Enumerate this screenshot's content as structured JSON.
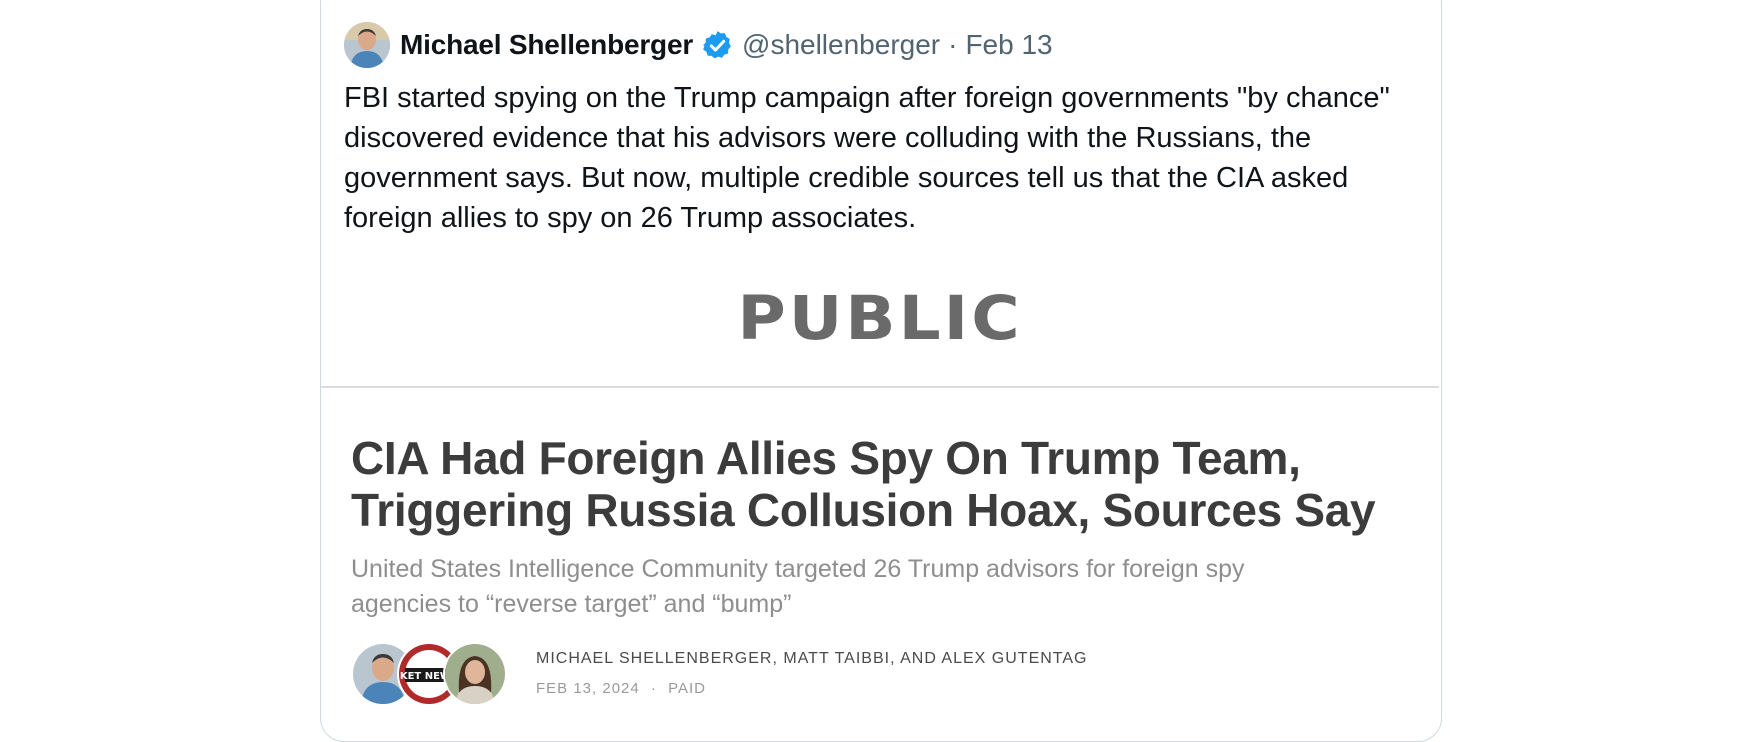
{
  "tweet": {
    "author_name": "Michael Shellenberger",
    "handle": "@shellenberger",
    "separator": "·",
    "date": "Feb 13",
    "text": "FBI started spying on the Trump campaign after foreign governments \"by chance\" discovered evidence that his advisors were colluding with the Russians, the government says. But now, multiple credible sources tell us that the CIA asked foreign allies to spy on 26 Trump associates."
  },
  "article": {
    "publication": "PUBLIC",
    "headline": "CIA Had Foreign Allies Spy On Trump Team, Triggering Russia Collusion Hoax, Sources Say",
    "subtitle": "United States Intelligence Community targeted 26 Trump advisors for foreign spy agencies to “reverse target” and “bump”",
    "authors": "MICHAEL SHELLENBERGER, MATT TAIBBI, AND ALEX GUTENTAG",
    "date": "FEB 13, 2024",
    "dot": "·",
    "access": "PAID",
    "badge_logo_text": "KET NEWS"
  },
  "colors": {
    "verified_badge": "#1d9bf0",
    "meta_text": "#536471",
    "headline_text": "#3c3c3c"
  },
  "icons": {
    "verified": "verified-badge-icon"
  }
}
